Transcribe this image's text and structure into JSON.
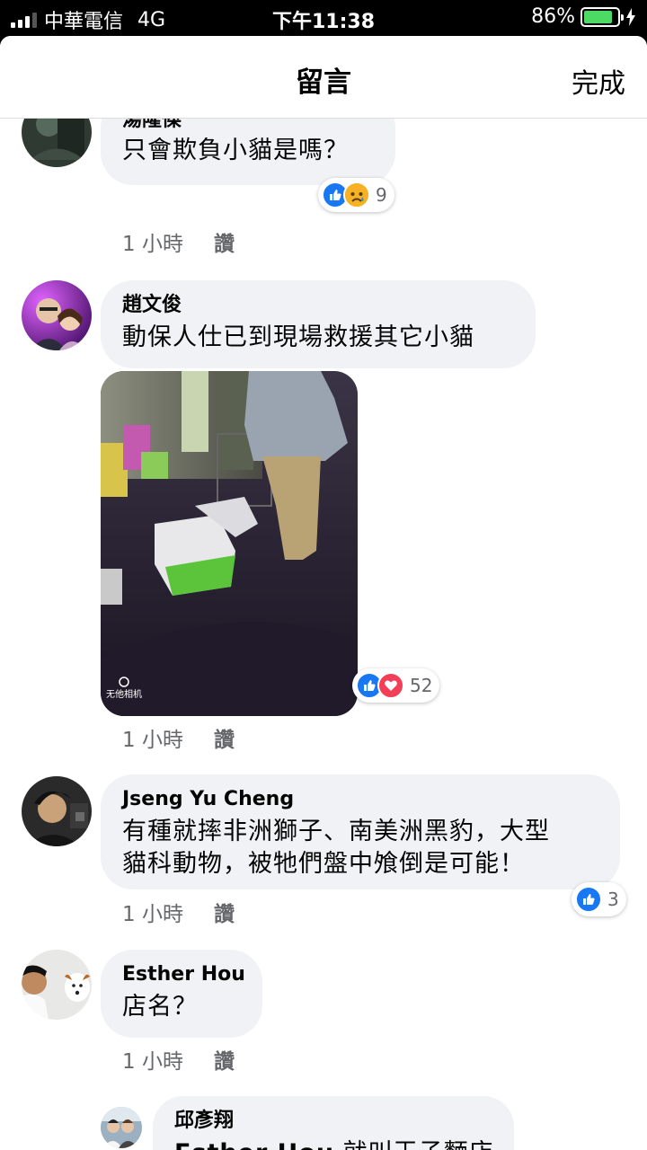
{
  "status_bar": {
    "carrier": "中華電信",
    "network": "4G",
    "time": "下午11:38",
    "battery": "86%",
    "battery_level": 0.86
  },
  "header": {
    "title": "留言",
    "done_label": "完成"
  },
  "comments": [
    {
      "author": "湯隆傑",
      "text": "只會欺負小貓是嗎？",
      "time": "1 小時",
      "reply_label": "讚",
      "reactions": [
        "like-icon",
        "sad-icon"
      ],
      "reaction_count": "9"
    },
    {
      "author": "趙文俊",
      "text": "動保人仕已到現場救援其它小貓",
      "time": "1 小時",
      "reply_label": "讚",
      "reactions": [
        "like-icon",
        "love-icon"
      ],
      "reaction_count": "52",
      "photo_watermark": "无他相机"
    },
    {
      "author": "Jseng Yu Cheng",
      "text_lines": [
        "有種就摔非洲獅子、南美洲黑豹，大型",
        "貓科動物，被牠們盤中飧倒是可能！"
      ],
      "time": "1 小時",
      "reply_label": "讚",
      "reactions": [
        "like-icon"
      ],
      "reaction_count": "3"
    },
    {
      "author": "Esther Hou",
      "text": "店名？",
      "time": "1 小時",
      "reply_label": "讚"
    }
  ],
  "reply": {
    "author": "邱彥翔",
    "mention": "Esther Hou",
    "text": "就叫王子麵店"
  },
  "colors": {
    "like": "#1877f2",
    "love": "#f33e58",
    "bubble": "#f0f2f5",
    "meta_text": "#65676b"
  }
}
